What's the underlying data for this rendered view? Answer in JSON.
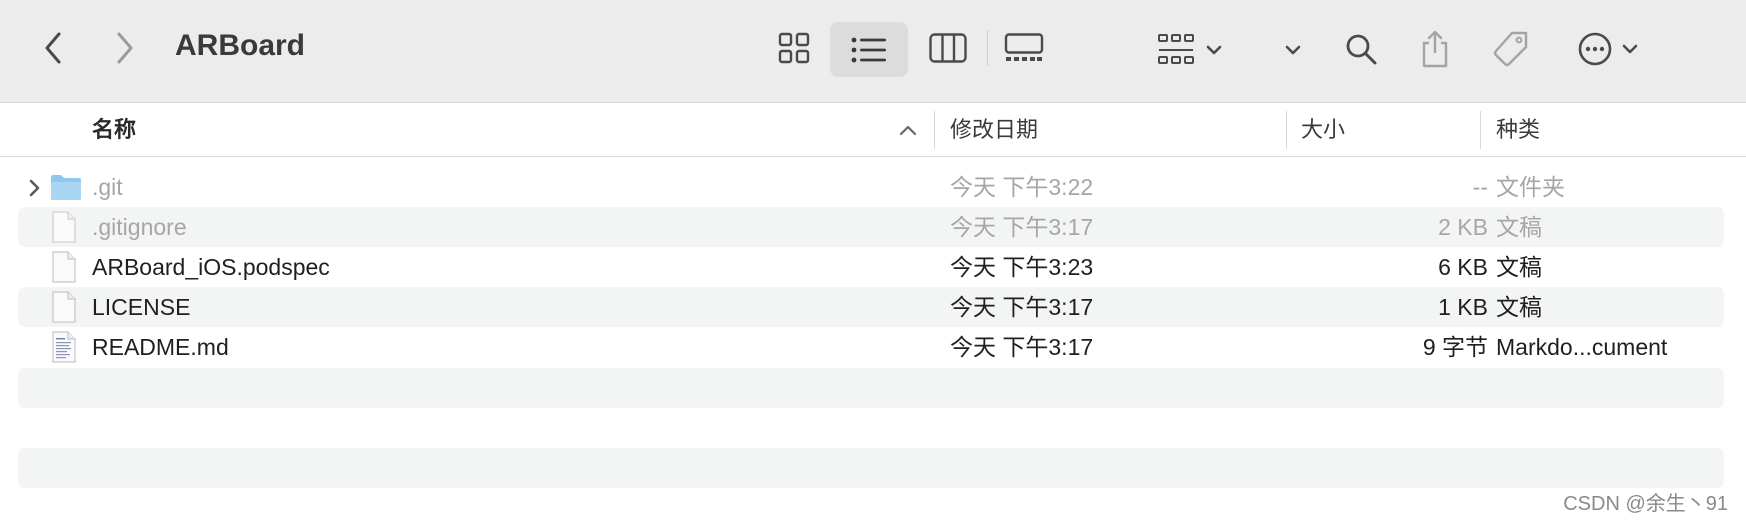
{
  "window": {
    "title": "ARBoard"
  },
  "toolbar": {
    "back": "chevron-left-icon",
    "forward": "chevron-right-icon",
    "view_modes": [
      "icon-view",
      "list-view",
      "column-view",
      "gallery-view"
    ],
    "active_view": "list-view"
  },
  "columns": {
    "name": "名称",
    "modified": "修改日期",
    "size": "大小",
    "kind": "种类"
  },
  "files": [
    {
      "name": ".git",
      "modified": "今天 下午3:22",
      "size": "--",
      "kind": "文件夹",
      "icon": "folder-icon",
      "hidden": true,
      "expandable": true
    },
    {
      "name": ".gitignore",
      "modified": "今天 下午3:17",
      "size": "2 KB",
      "kind": "文稿",
      "icon": "document-icon",
      "hidden": true,
      "expandable": false
    },
    {
      "name": "ARBoard_iOS.podspec",
      "modified": "今天 下午3:23",
      "size": "6 KB",
      "kind": "文稿",
      "icon": "document-icon",
      "hidden": false,
      "expandable": false
    },
    {
      "name": "LICENSE",
      "modified": "今天 下午3:17",
      "size": "1 KB",
      "kind": "文稿",
      "icon": "document-icon",
      "hidden": false,
      "expandable": false
    },
    {
      "name": "README.md",
      "modified": "今天 下午3:17",
      "size": "9 字节",
      "kind": "Markdo...cument",
      "icon": "markdown-file-icon",
      "hidden": false,
      "expandable": false
    }
  ],
  "watermark": "CSDN @余生丶91",
  "colors": {
    "toolbar_bg": "#ececec",
    "row_alt": "#f3f4f4",
    "hidden_text": "#a6a6a6"
  }
}
